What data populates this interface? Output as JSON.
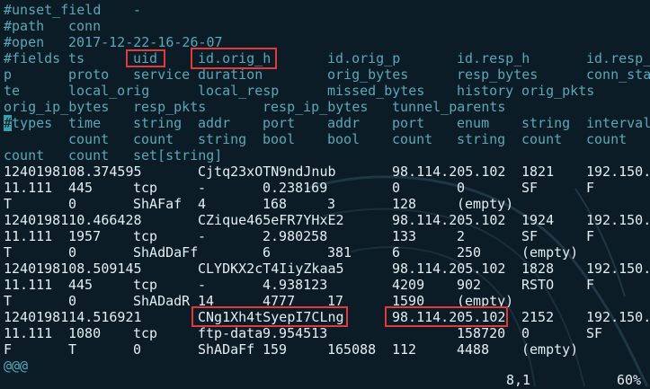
{
  "lines": [
    {
      "y": 0,
      "cls": "hdr",
      "cells": [
        [
          "#unset_field",
          4
        ],
        [
          "-",
          148
        ]
      ]
    },
    {
      "y": 1,
      "cls": "hdr",
      "cells": [
        [
          "#path",
          4
        ],
        [
          "conn",
          76
        ]
      ]
    },
    {
      "y": 2,
      "cls": "hdr",
      "cells": [
        [
          "#open",
          4
        ],
        [
          "2017-12-22-16-26-07",
          76
        ]
      ]
    },
    {
      "y": 3,
      "cls": "hdr",
      "cells": [
        [
          "#fields",
          4
        ],
        [
          "ts",
          76
        ],
        [
          "uid",
          148
        ],
        [
          "id.orig_h",
          220
        ],
        [
          "id.orig_p",
          364
        ],
        [
          "id.resp_h",
          508
        ],
        [
          "id.resp_",
          652
        ]
      ]
    },
    {
      "y": 4,
      "cls": "hdr",
      "cells": [
        [
          "p",
          4
        ],
        [
          "proto",
          76
        ],
        [
          "service",
          148
        ],
        [
          "duration",
          220
        ],
        [
          "orig_bytes",
          364
        ],
        [
          "resp_bytes",
          508
        ],
        [
          "conn_sta",
          652
        ]
      ]
    },
    {
      "y": 5,
      "cls": "hdr",
      "cells": [
        [
          "te",
          4
        ],
        [
          "local_orig",
          76
        ],
        [
          "local_resp",
          220
        ],
        [
          "missed_bytes",
          364
        ],
        [
          "history",
          508
        ],
        [
          "orig_pkts",
          580
        ]
      ]
    },
    {
      "y": 6,
      "cls": "hdr",
      "cells": [
        [
          "orig_ip_bytes",
          4
        ],
        [
          "resp_pkts",
          148
        ],
        [
          "resp_ip_bytes",
          292
        ],
        [
          "tunnel_parents",
          436
        ]
      ]
    },
    {
      "y": 7,
      "cls": "hdr",
      "cells": [
        [
          "#types",
          4
        ],
        [
          "time",
          76
        ],
        [
          "string",
          148
        ],
        [
          "addr",
          220
        ],
        [
          "port",
          292
        ],
        [
          "addr",
          364
        ],
        [
          "port",
          436
        ],
        [
          "enum",
          508
        ],
        [
          "string",
          580
        ],
        [
          "interval",
          652
        ]
      ]
    },
    {
      "y": 8,
      "cls": "hdr",
      "cells": [
        [
          "count",
          76
        ],
        [
          "count",
          148
        ],
        [
          "string",
          220
        ],
        [
          "bool",
          292
        ],
        [
          "bool",
          364
        ],
        [
          "count",
          436
        ],
        [
          "string",
          508
        ],
        [
          "count",
          580
        ],
        [
          "count",
          652
        ]
      ]
    },
    {
      "y": 9,
      "cls": "hdr",
      "cells": [
        [
          "count",
          4
        ],
        [
          "count",
          76
        ],
        [
          "set[string]",
          148
        ]
      ]
    },
    {
      "y": 10,
      "cls": "data",
      "cells": [
        [
          "1240198108.374595",
          4
        ],
        [
          "Cjtq23xOTN9ndJnub",
          220
        ],
        [
          "98.114.205.102",
          436
        ],
        [
          "1821",
          580
        ],
        [
          "192.150.",
          652
        ]
      ]
    },
    {
      "y": 11,
      "cls": "data",
      "cells": [
        [
          "11.111",
          4
        ],
        [
          "445",
          76
        ],
        [
          "tcp",
          148
        ],
        [
          "-",
          220
        ],
        [
          "0.238169",
          292
        ],
        [
          "0",
          436
        ],
        [
          "0",
          508
        ],
        [
          "SF",
          580
        ],
        [
          "F",
          652
        ]
      ]
    },
    {
      "y": 12,
      "cls": "data",
      "cells": [
        [
          "T",
          4
        ],
        [
          "0",
          76
        ],
        [
          "ShAFaf",
          148
        ],
        [
          "4",
          220
        ],
        [
          "168",
          292
        ],
        [
          "3",
          364
        ],
        [
          "128",
          436
        ],
        [
          "(empty)",
          508
        ]
      ]
    },
    {
      "y": 13,
      "cls": "data",
      "cells": [
        [
          "1240198110.466428",
          4
        ],
        [
          "CZique465eFR7YHxE2",
          220
        ],
        [
          "98.114.205.102",
          436
        ],
        [
          "1924",
          580
        ],
        [
          "192.150.",
          652
        ]
      ]
    },
    {
      "y": 14,
      "cls": "data",
      "cells": [
        [
          "11.111",
          4
        ],
        [
          "1957",
          76
        ],
        [
          "tcp",
          148
        ],
        [
          "-",
          220
        ],
        [
          "2.980258",
          292
        ],
        [
          "133",
          436
        ],
        [
          "2",
          508
        ],
        [
          "SF",
          580
        ],
        [
          "F",
          652
        ]
      ]
    },
    {
      "y": 15,
      "cls": "data",
      "cells": [
        [
          "T",
          4
        ],
        [
          "0",
          76
        ],
        [
          "ShAdDaFf",
          148
        ],
        [
          "6",
          292
        ],
        [
          "381",
          364
        ],
        [
          "6",
          436
        ],
        [
          "250",
          508
        ],
        [
          "(empty)",
          580
        ]
      ]
    },
    {
      "y": 16,
      "cls": "data",
      "cells": [
        [
          "1240198108.509145",
          4
        ],
        [
          "CLYDKX2cT4IiyZkaa5",
          220
        ],
        [
          "98.114.205.102",
          436
        ],
        [
          "1828",
          580
        ],
        [
          "192.150.",
          652
        ]
      ]
    },
    {
      "y": 17,
      "cls": "data",
      "cells": [
        [
          "11.111",
          4
        ],
        [
          "445",
          76
        ],
        [
          "tcp",
          148
        ],
        [
          "-",
          220
        ],
        [
          "4.938123",
          292
        ],
        [
          "4209",
          436
        ],
        [
          "902",
          508
        ],
        [
          "RSTO",
          580
        ],
        [
          "F",
          652
        ]
      ]
    },
    {
      "y": 18,
      "cls": "data",
      "cells": [
        [
          "T",
          4
        ],
        [
          "0",
          76
        ],
        [
          "ShADadR",
          148
        ],
        [
          "14",
          220
        ],
        [
          "4777",
          292
        ],
        [
          "17",
          364
        ],
        [
          "1590",
          436
        ],
        [
          "(empty)",
          508
        ]
      ]
    },
    {
      "y": 19,
      "cls": "data",
      "cells": [
        [
          "1240198114.516921",
          4
        ],
        [
          "CNg1Xh4tSyepI7CLng",
          220
        ],
        [
          "98.114.205.102",
          436
        ],
        [
          "2152",
          580
        ],
        [
          "192.150.",
          652
        ]
      ]
    },
    {
      "y": 20,
      "cls": "data",
      "cells": [
        [
          "11.111",
          4
        ],
        [
          "1080",
          76
        ],
        [
          "tcp",
          148
        ],
        [
          "ftp-data",
          220
        ],
        [
          "9.954513",
          292
        ],
        [
          "158720",
          508
        ],
        [
          "0",
          580
        ],
        [
          "SF",
          652
        ]
      ]
    },
    {
      "y": 21,
      "cls": "data",
      "cells": [
        [
          "F",
          4
        ],
        [
          "T",
          76
        ],
        [
          "0",
          148
        ],
        [
          "ShADaFf",
          220
        ],
        [
          "159",
          292
        ],
        [
          "165088",
          364
        ],
        [
          "112",
          436
        ],
        [
          "4488",
          508
        ],
        [
          "(empty)",
          580
        ]
      ]
    },
    {
      "y": 22,
      "cls": "hdr",
      "cells": [
        [
          "@@@",
          4
        ]
      ]
    }
  ],
  "cursor_char": "#",
  "status": {
    "position": "8,1",
    "percent": "60%"
  }
}
